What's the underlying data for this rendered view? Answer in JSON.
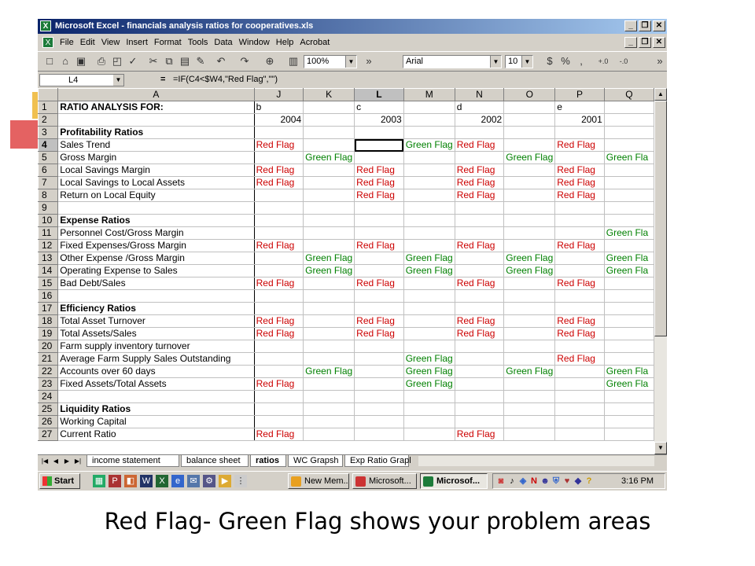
{
  "window": {
    "title": "Microsoft Excel - financials analysis ratios for cooperatives.xls"
  },
  "menu": [
    "File",
    "Edit",
    "View",
    "Insert",
    "Format",
    "Tools",
    "Data",
    "Window",
    "Help",
    "Acrobat"
  ],
  "toolbar": {
    "zoom": "100%",
    "font": "Arial",
    "font_size": "10",
    "currency": "$",
    "percent": "%",
    "comma": ","
  },
  "formula_bar": {
    "cell_ref": "L4",
    "equals": "=",
    "formula": "=IF(C4<$W4,\"Red Flag\",\"\")"
  },
  "columns": [
    "A",
    "J",
    "K",
    "L",
    "M",
    "N",
    "O",
    "P",
    "Q"
  ],
  "selected_column": "L",
  "selected_row": "4",
  "rows": [
    {
      "n": "1",
      "a": "RATIO ANALYSIS FOR:",
      "bold": true,
      "j": "b",
      "k": "",
      "l": "c",
      "m": "",
      "nn": "d",
      "o": "",
      "p": "e",
      "q": ""
    },
    {
      "n": "2",
      "a": "",
      "j": "2004",
      "k": "",
      "l": "2003",
      "m": "",
      "nn": "2002",
      "o": "",
      "p": "2001",
      "q": "",
      "num": true
    },
    {
      "n": "3",
      "a": "Profitability Ratios",
      "bold": true,
      "j": "",
      "k": "",
      "l": "",
      "m": "",
      "nn": "",
      "o": "",
      "p": "",
      "q": ""
    },
    {
      "n": "4",
      "a": "Sales Trend",
      "j": "Red Flag",
      "k": "",
      "l": "",
      "m": "Green Flag",
      "nn": "Red Flag",
      "o": "",
      "p": "Red Flag",
      "q": ""
    },
    {
      "n": "5",
      "a": "Gross Margin",
      "j": "",
      "k": "Green Flag",
      "l": "",
      "m": "",
      "nn": "",
      "o": "Green Flag",
      "p": "",
      "q": "Green Fla"
    },
    {
      "n": "6",
      "a": "Local Savings Margin",
      "j": "Red Flag",
      "k": "",
      "l": "Red Flag",
      "m": "",
      "nn": "Red Flag",
      "o": "",
      "p": "Red Flag",
      "q": ""
    },
    {
      "n": "7",
      "a": "Local Savings to Local Assets",
      "j": "Red Flag",
      "k": "",
      "l": "Red Flag",
      "m": "",
      "nn": "Red Flag",
      "o": "",
      "p": "Red Flag",
      "q": ""
    },
    {
      "n": "8",
      "a": "Return on Local Equity",
      "j": "",
      "k": "",
      "l": "Red Flag",
      "m": "",
      "nn": "Red Flag",
      "o": "",
      "p": "Red Flag",
      "q": ""
    },
    {
      "n": "9",
      "a": "",
      "j": "",
      "k": "",
      "l": "",
      "m": "",
      "nn": "",
      "o": "",
      "p": "",
      "q": ""
    },
    {
      "n": "10",
      "a": "Expense Ratios",
      "bold": true,
      "j": "",
      "k": "",
      "l": "",
      "m": "",
      "nn": "",
      "o": "",
      "p": "",
      "q": ""
    },
    {
      "n": "11",
      "a": "Personnel Cost/Gross Margin",
      "j": "",
      "k": "",
      "l": "",
      "m": "",
      "nn": "",
      "o": "",
      "p": "",
      "q": "Green Fla"
    },
    {
      "n": "12",
      "a": "Fixed Expenses/Gross Margin",
      "j": "Red Flag",
      "k": "",
      "l": "Red Flag",
      "m": "",
      "nn": "Red Flag",
      "o": "",
      "p": "Red Flag",
      "q": ""
    },
    {
      "n": "13",
      "a": "Other Expense /Gross Margin",
      "j": "",
      "k": "Green Flag",
      "l": "",
      "m": "Green Flag",
      "nn": "",
      "o": "Green Flag",
      "p": "",
      "q": "Green Fla"
    },
    {
      "n": "14",
      "a": "Operating Expense to Sales",
      "j": "",
      "k": "Green Flag",
      "l": "",
      "m": "Green Flag",
      "nn": "",
      "o": "Green Flag",
      "p": "",
      "q": "Green Fla"
    },
    {
      "n": "15",
      "a": "Bad Debt/Sales",
      "j": "Red Flag",
      "k": "",
      "l": "Red Flag",
      "m": "",
      "nn": "Red Flag",
      "o": "",
      "p": "Red Flag",
      "q": ""
    },
    {
      "n": "16",
      "a": "",
      "j": "",
      "k": "",
      "l": "",
      "m": "",
      "nn": "",
      "o": "",
      "p": "",
      "q": ""
    },
    {
      "n": "17",
      "a": "Efficiency Ratios",
      "bold": true,
      "j": "",
      "k": "",
      "l": "",
      "m": "",
      "nn": "",
      "o": "",
      "p": "",
      "q": ""
    },
    {
      "n": "18",
      "a": "Total Asset Turnover",
      "j": "Red Flag",
      "k": "",
      "l": "Red Flag",
      "m": "",
      "nn": "Red Flag",
      "o": "",
      "p": "Red Flag",
      "q": ""
    },
    {
      "n": "19",
      "a": "Total Assets/Sales",
      "j": "Red Flag",
      "k": "",
      "l": "Red Flag",
      "m": "",
      "nn": "Red Flag",
      "o": "",
      "p": "Red Flag",
      "q": ""
    },
    {
      "n": "20",
      "a": "Farm supply inventory turnover",
      "j": "",
      "k": "",
      "l": "",
      "m": "",
      "nn": "",
      "o": "",
      "p": "",
      "q": ""
    },
    {
      "n": "21",
      "a": "Average Farm Supply Sales Outstanding",
      "j": "",
      "k": "",
      "l": "",
      "m": "Green Flag",
      "nn": "",
      "o": "",
      "p": "Red Flag",
      "q": ""
    },
    {
      "n": "22",
      "a": "Accounts over 60 days",
      "j": "",
      "k": "Green Flag",
      "l": "",
      "m": "Green Flag",
      "nn": "",
      "o": "Green Flag",
      "p": "",
      "q": "Green Fla"
    },
    {
      "n": "23",
      "a": "Fixed Assets/Total Assets",
      "j": "Red Flag",
      "k": "",
      "l": "",
      "m": "Green Flag",
      "nn": "",
      "o": "",
      "p": "",
      "q": "Green Fla"
    },
    {
      "n": "24",
      "a": "",
      "j": "",
      "k": "",
      "l": "",
      "m": "",
      "nn": "",
      "o": "",
      "p": "",
      "q": ""
    },
    {
      "n": "25",
      "a": "Liquidity Ratios",
      "bold": true,
      "j": "",
      "k": "",
      "l": "",
      "m": "",
      "nn": "",
      "o": "",
      "p": "",
      "q": ""
    },
    {
      "n": "26",
      "a": "Working Capital",
      "j": "",
      "k": "",
      "l": "",
      "m": "",
      "nn": "",
      "o": "",
      "p": "",
      "q": ""
    },
    {
      "n": "27",
      "a": "Current Ratio",
      "j": "Red Flag",
      "k": "",
      "l": "",
      "m": "",
      "nn": "Red Flag",
      "o": "",
      "p": "",
      "q": ""
    }
  ],
  "sheet_tabs": [
    "income statement",
    "balance sheet",
    "ratios",
    "WC Grapsh",
    "Exp Ratio Grapl"
  ],
  "active_tab": "ratios",
  "taskbar": {
    "start": "Start",
    "buttons": [
      "New Mem...",
      "Microsoft...",
      "Microsof..."
    ],
    "clock": "3:16 PM"
  },
  "caption": "Red Flag- Green Flag shows your problem areas",
  "colors": {
    "red_flag": "#cc0000",
    "green_flag": "#008000",
    "title_bar": "#0a246a"
  }
}
